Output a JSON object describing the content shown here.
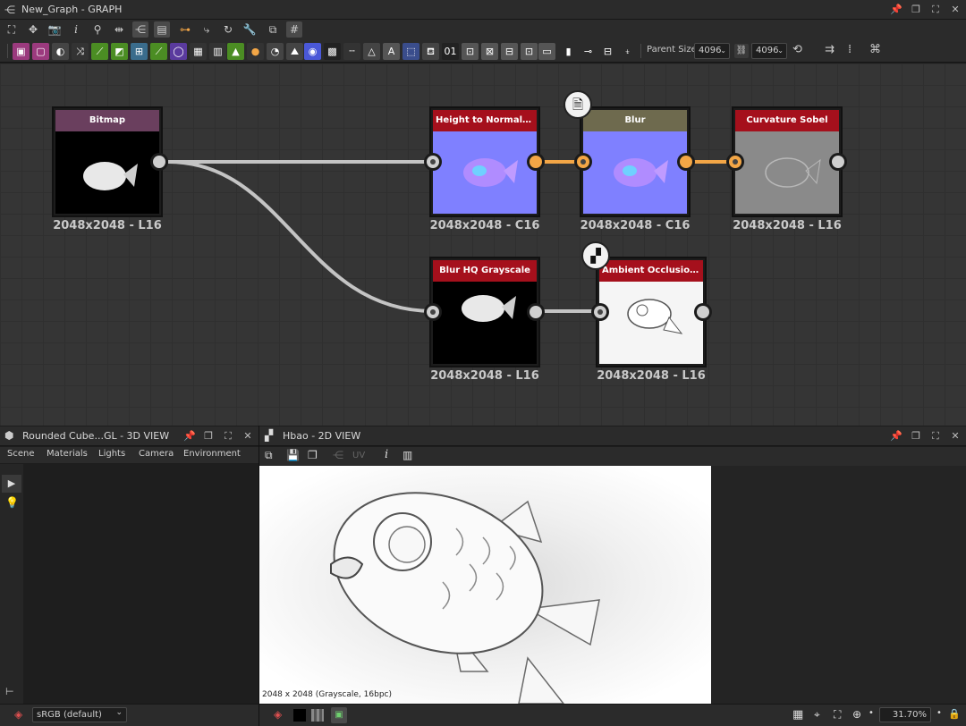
{
  "graph_window": {
    "title": "New_Graph - GRAPH"
  },
  "toolbar": {
    "parent_size_label": "Parent Size:",
    "parent_size_value": "4096",
    "output_size_value": "4096"
  },
  "nodes": [
    {
      "id": "bitmap",
      "title": "Bitmap",
      "size": "2048x2048 - L16",
      "header_color": "#6a3f5e",
      "preview": "fish-white"
    },
    {
      "id": "height-normal",
      "title": "Height to Normal World...",
      "size": "2048x2048 - C16",
      "header_color": "#a5101c",
      "preview": "fish-normal"
    },
    {
      "id": "blur",
      "title": "Blur",
      "size": "2048x2048 - C16",
      "header_color": "#6e6a4e",
      "preview": "fish-normal"
    },
    {
      "id": "curvature",
      "title": "Curvature Sobel",
      "size": "2048x2048 - L16",
      "header_color": "#a5101c",
      "preview": "fish-gray"
    },
    {
      "id": "blur-hq",
      "title": "Blur HQ Grayscale",
      "size": "2048x2048 - L16",
      "header_color": "#a5101c",
      "preview": "fish-white"
    },
    {
      "id": "ao",
      "title": "Ambient Occlusion (HB...",
      "size": "2048x2048 - L16",
      "header_color": "#a5101c",
      "preview": "fish-ao"
    }
  ],
  "view3d": {
    "title": "Rounded Cube...GL - 3D VIEW",
    "menu": [
      "Scene",
      "Materials",
      "Lights",
      "Camera",
      "Environment"
    ],
    "colorspace": "sRGB (default)"
  },
  "view2d": {
    "title": "Hbao - 2D VIEW",
    "uv_label": "UV",
    "image_info": "2048 x 2048 (Grayscale, 16bpc)",
    "zoom": "31.70%"
  },
  "colors": {
    "accent_orange": "#f3a646",
    "node_header_red": "#a5101c",
    "graph_bg": "#353535"
  }
}
